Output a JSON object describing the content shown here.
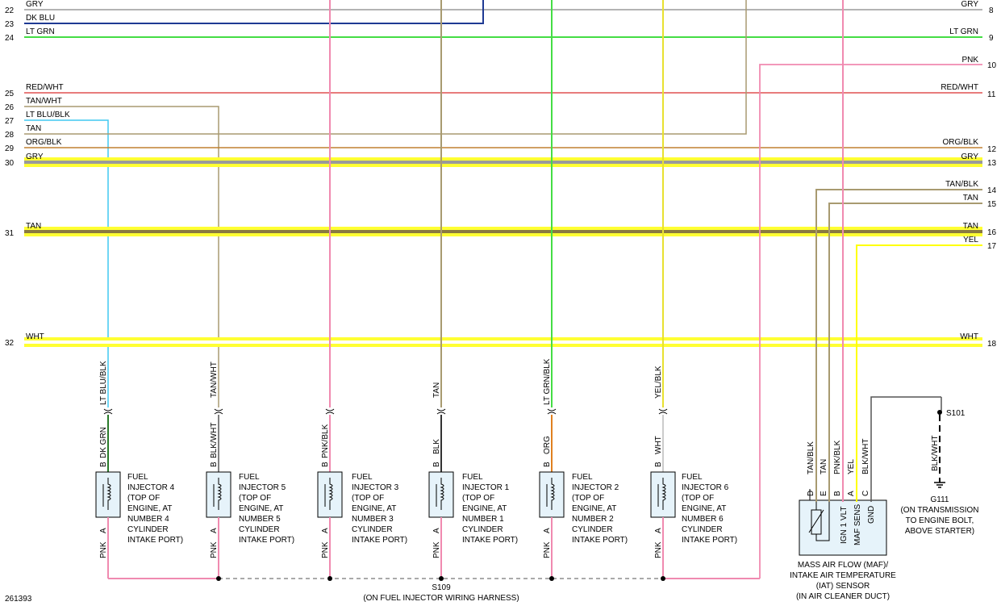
{
  "left_rows": [
    {
      "num": "22",
      "label": "GRY"
    },
    {
      "num": "23",
      "label": "DK BLU"
    },
    {
      "num": "24",
      "label": "LT GRN"
    },
    {
      "num": "25",
      "label": "RED/WHT"
    },
    {
      "num": "26",
      "label": "TAN/WHT"
    },
    {
      "num": "27",
      "label": "LT BLU/BLK"
    },
    {
      "num": "28",
      "label": "TAN"
    },
    {
      "num": "29",
      "label": "ORG/BLK"
    },
    {
      "num": "30",
      "label": "GRY"
    },
    {
      "num": "31",
      "label": "TAN"
    },
    {
      "num": "32",
      "label": "WHT"
    }
  ],
  "right_rows": [
    {
      "num": "8",
      "label": "GRY"
    },
    {
      "num": "9",
      "label": "LT GRN"
    },
    {
      "num": "10",
      "label": "PNK"
    },
    {
      "num": "11",
      "label": "RED/WHT"
    },
    {
      "num": "12",
      "label": "ORG/BLK"
    },
    {
      "num": "13",
      "label": "GRY"
    },
    {
      "num": "14",
      "label": "TAN/BLK"
    },
    {
      "num": "15",
      "label": "TAN"
    },
    {
      "num": "16",
      "label": "TAN"
    },
    {
      "num": "17",
      "label": "YEL"
    },
    {
      "num": "18",
      "label": "WHT"
    }
  ],
  "injectors": [
    {
      "wire_top": "LT BLU/BLK",
      "wire_b": "DK GRN",
      "pin_b": "B",
      "pin_a": "A",
      "wire_a": "PNK",
      "lines": [
        "FUEL",
        "INJECTOR 4",
        "(TOP OF",
        "ENGINE, AT",
        "NUMBER 4",
        "CYLINDER",
        "INTAKE PORT)"
      ]
    },
    {
      "wire_top": "TAN/WHT",
      "wire_b": "BLK/WHT",
      "pin_b": "B",
      "pin_a": "A",
      "wire_a": "PNK",
      "lines": [
        "FUEL",
        "INJECTOR 5",
        "(TOP OF",
        "ENGINE, AT",
        "NUMBER 5",
        "CYLINDER",
        "INTAKE PORT)"
      ]
    },
    {
      "wire_top": "",
      "wire_b": "PNK/BLK",
      "pin_b": "B",
      "pin_a": "A",
      "wire_a": "PNK",
      "lines": [
        "FUEL",
        "INJECTOR 3",
        "(TOP OF",
        "ENGINE, AT",
        "NUMBER 3",
        "CYLINDER",
        "INTAKE PORT)"
      ]
    },
    {
      "wire_top": "TAN",
      "wire_b": "BLK",
      "pin_b": "B",
      "pin_a": "A",
      "wire_a": "PNK",
      "lines": [
        "FUEL",
        "INJECTOR 1",
        "(TOP OF",
        "ENGINE, AT",
        "NUMBER 1",
        "CYLINDER",
        "INTAKE PORT)"
      ]
    },
    {
      "wire_top": "LT GRN/BLK",
      "wire_b": "ORG",
      "pin_b": "B",
      "pin_a": "A",
      "wire_a": "PNK",
      "lines": [
        "FUEL",
        "INJECTOR 2",
        "(TOP OF",
        "ENGINE, AT",
        "NUMBER 2",
        "CYLINDER",
        "INTAKE PORT)"
      ]
    },
    {
      "wire_top": "YEL/BLK",
      "wire_b": "WHT",
      "pin_b": "B",
      "pin_a": "A",
      "wire_a": "PNK",
      "lines": [
        "FUEL",
        "INJECTOR 6",
        "(TOP OF",
        "ENGINE, AT",
        "NUMBER 6",
        "CYLINDER",
        "INTAKE PORT)"
      ]
    }
  ],
  "maf": {
    "wires": [
      "TAN/BLK",
      "TAN",
      "PNK/BLK",
      "YEL",
      "BLK/WHT"
    ],
    "pins": [
      "D",
      "E",
      "B",
      "A",
      "C"
    ],
    "inner": [
      "IGN 1 VLT",
      "MAF SENS",
      "GND"
    ],
    "caption": [
      "MASS AIR FLOW (MAF)/",
      "INTAKE AIR TEMPERATURE",
      "(IAT) SENSOR",
      "(IN AIR CLEANER DUCT)"
    ]
  },
  "splice_s101": "S101",
  "ground": {
    "wire": "BLK/WHT",
    "id": "G111",
    "caption": [
      "(ON TRANSMISSION",
      "TO ENGINE BOLT,",
      "ABOVE STARTER)"
    ]
  },
  "splice_s109": {
    "id": "S109",
    "caption": "(ON FUEL INJECTOR WIRING HARNESS)"
  },
  "figure_id": "261393",
  "colors": {
    "gry": "#9a9a9a",
    "dkblu": "#1f3a93",
    "ltgrn": "#44dd44",
    "pnk": "#f08ab0",
    "redwht": "#e05050",
    "tan": "#a89a70",
    "ltblu": "#40c8f0",
    "org": "#c08030",
    "yel": "#ffff00",
    "grn": "#2a7a2a"
  }
}
